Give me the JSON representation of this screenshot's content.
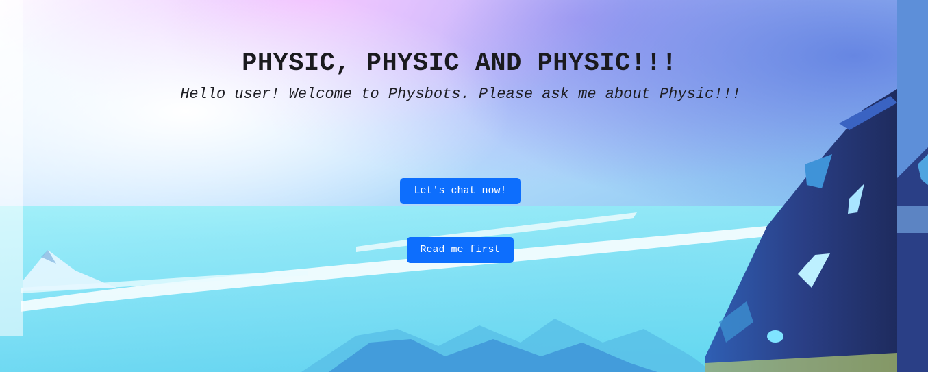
{
  "hero": {
    "title": "PHYSIC, PHYSIC AND PHYSIC!!!",
    "subtitle": "Hello user! Welcome to Physbots. Please ask me about Physic!!!"
  },
  "buttons": {
    "chat_label": "Let's chat now!",
    "read_label": "Read me first"
  },
  "colors": {
    "button_bg": "#0d6efd",
    "button_text": "#ffffff",
    "title_text": "#1a1a1e"
  }
}
